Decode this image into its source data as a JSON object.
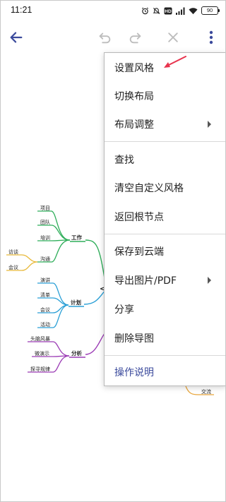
{
  "status_bar": {
    "time": "11:21",
    "battery": "90",
    "icons": [
      "alarm-icon",
      "mute-icon",
      "hd-icon",
      "signal-icon",
      "wifi-icon",
      "battery-icon"
    ]
  },
  "toolbar": {
    "back_icon": "back-arrow-icon",
    "undo_icon": "undo-icon",
    "redo_icon": "redo-icon",
    "close_icon": "close-icon",
    "more_icon": "more-vert-icon",
    "accent_color": "#3b4a9c",
    "disabled_color": "#bdbdbd"
  },
  "menu": {
    "items": [
      {
        "label": "设置风格",
        "submenu": false
      },
      {
        "label": "切换布局",
        "submenu": false
      },
      {
        "label": "布局调整",
        "submenu": true
      },
      {
        "label": "查找",
        "submenu": false
      },
      {
        "label": "清空自定义风格",
        "submenu": false
      },
      {
        "label": "返回根节点",
        "submenu": false
      },
      {
        "label": "保存到云端",
        "submenu": false
      },
      {
        "label": "导出图片/PDF",
        "submenu": true
      },
      {
        "label": "分享",
        "submenu": false
      },
      {
        "label": "删除导图",
        "submenu": false
      },
      {
        "label": "操作说明",
        "submenu": false
      }
    ],
    "highlight_arrow_color": "#e8344e"
  },
  "mindmap": {
    "branches": [
      {
        "label": "工作",
        "color": "#2fae5a",
        "children": [
          "项目",
          "团队",
          "培训",
          "沟通"
        ],
        "grandchildren": {
          "沟通": [
            "访谈",
            "会议"
          ]
        }
      },
      {
        "label": "计划",
        "color": "#2a9fd6",
        "children": [
          "演讲",
          "清单",
          "会议",
          "活动"
        ]
      },
      {
        "label": "分析",
        "color": "#9b3bb5",
        "children": [
          "头脑风暴",
          "微演示",
          "探寻规律"
        ]
      }
    ],
    "right_node": {
      "label": "交流",
      "color": "#e8a53a"
    }
  }
}
